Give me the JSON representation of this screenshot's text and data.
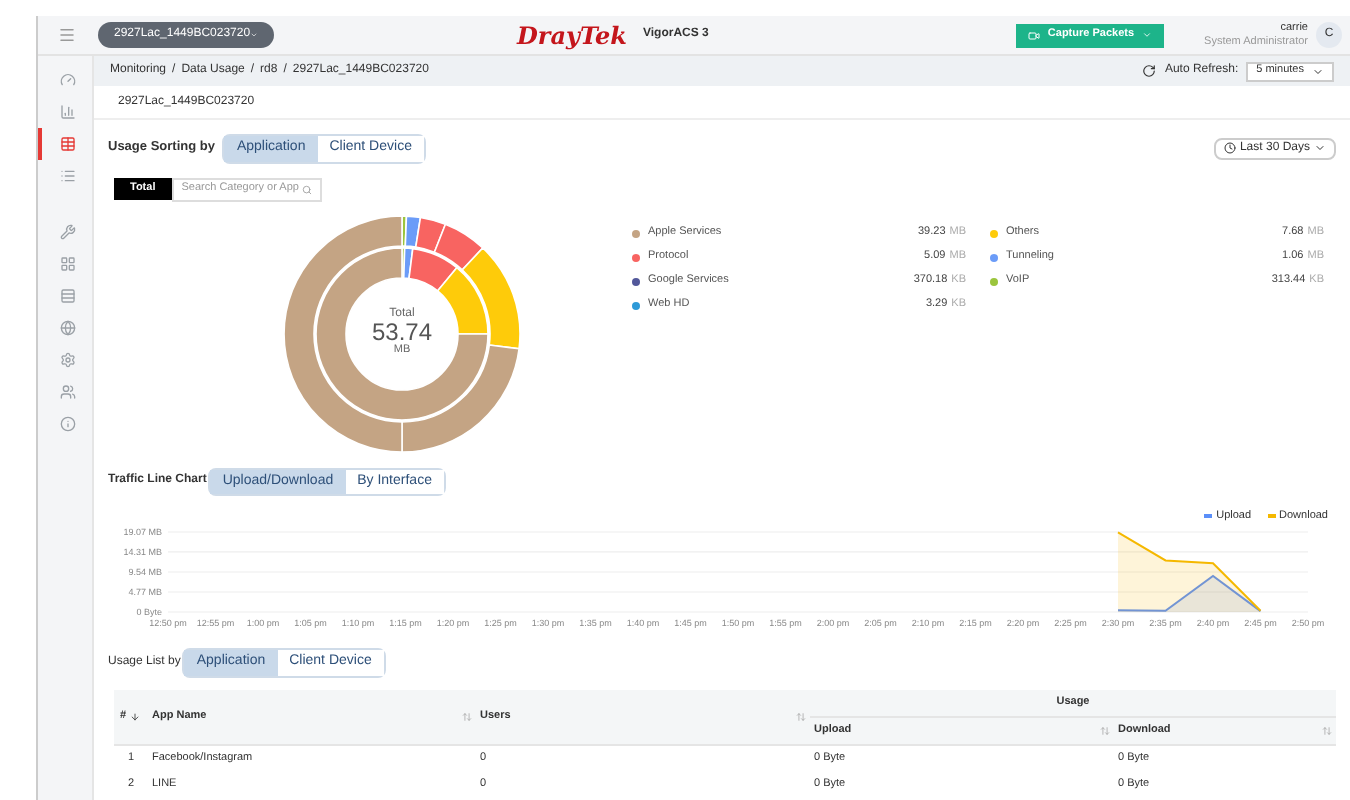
{
  "topbar": {
    "device": "2927Lac_1449BC023720",
    "logo_brand": "DrayTek",
    "logo_product": "VigorACS 3",
    "capture_button": "Capture Packets",
    "user": {
      "name": "carrie",
      "role": "System Administrator",
      "initial": "C"
    }
  },
  "sidebar": {
    "items": [
      {
        "selected": false
      },
      {
        "selected": false
      },
      {
        "selected": true
      },
      {
        "selected": false
      },
      {
        "selected": false
      },
      {
        "selected": false
      },
      {
        "selected": false
      },
      {
        "selected": false
      },
      {
        "selected": false
      },
      {
        "selected": false
      },
      {
        "selected": false
      }
    ]
  },
  "breadcrumb": {
    "separator": "/",
    "items": [
      "Monitoring",
      "Data Usage",
      "rd8",
      "2927Lac_1449BC023720"
    ]
  },
  "auto_refresh": {
    "label": "Auto Refresh:",
    "value": "5 minutes"
  },
  "device_name": "2927Lac_1449BC023720",
  "usage_sorting": {
    "label": "Usage Sorting by",
    "options": [
      {
        "label": "Application",
        "selected": true
      },
      {
        "label": "Client Device",
        "selected": false
      }
    ]
  },
  "date_range": "Last 30 Days",
  "filter": {
    "tag": "Total",
    "placeholder": "Search Category or App"
  },
  "donut": {
    "center_label": "Total",
    "center_value": "53.74",
    "center_unit": "MB"
  },
  "legend": [
    {
      "name": "Apple Services",
      "value": "39.23",
      "unit": "MB",
      "color": "#c4a484"
    },
    {
      "name": "Protocol",
      "value": "5.09",
      "unit": "MB",
      "color": "#f86461"
    },
    {
      "name": "Google Services",
      "value": "370.18",
      "unit": "KB",
      "color": "#52589a"
    },
    {
      "name": "Web HD",
      "value": "3.29",
      "unit": "KB",
      "color": "#2e9ad8"
    },
    {
      "name": "Others",
      "value": "7.68",
      "unit": "MB",
      "color": "#fecb0a"
    },
    {
      "name": "Tunneling",
      "value": "1.06",
      "unit": "MB",
      "color": "#6b9cf8"
    },
    {
      "name": "VoIP",
      "value": "313.44",
      "unit": "KB",
      "color": "#9bc53d"
    }
  ],
  "traffic": {
    "label": "Traffic Line Chart",
    "options": [
      {
        "label": "Upload/Download",
        "selected": true
      },
      {
        "label": "By Interface",
        "selected": false
      }
    ],
    "chart_data": {
      "type": "area",
      "grid": true,
      "ylim": [
        0,
        19.07
      ],
      "categories": [
        "12:50 pm",
        "12:55 pm",
        "1:00 pm",
        "1:05 pm",
        "1:10 pm",
        "1:15 pm",
        "1:20 pm",
        "1:25 pm",
        "1:30 pm",
        "1:35 pm",
        "1:40 pm",
        "1:45 pm",
        "1:50 pm",
        "1:55 pm",
        "2:00 pm",
        "2:05 pm",
        "2:10 pm",
        "2:15 pm",
        "2:20 pm",
        "2:25 pm",
        "2:30 pm",
        "2:35 pm",
        "2:40 pm",
        "2:45 pm",
        "2:50 pm"
      ],
      "yticks": [
        {
          "value": 0,
          "label": "0 Byte"
        },
        {
          "value": 4.77,
          "label": "4.77 MB"
        },
        {
          "value": 9.54,
          "label": "9.54 MB"
        },
        {
          "value": 14.31,
          "label": "14.31 MB"
        },
        {
          "value": 19.07,
          "label": "19.07 MB"
        }
      ],
      "series": [
        {
          "name": "Upload",
          "color": "#5b8ff9",
          "values": [
            null,
            null,
            null,
            null,
            null,
            null,
            null,
            null,
            null,
            null,
            null,
            null,
            null,
            null,
            null,
            null,
            null,
            null,
            null,
            null,
            0.4,
            0.3,
            8.6,
            0.2,
            null
          ]
        },
        {
          "name": "Download",
          "color": "#f5b800",
          "values": [
            null,
            null,
            null,
            null,
            null,
            null,
            null,
            null,
            null,
            null,
            null,
            null,
            null,
            null,
            null,
            null,
            null,
            null,
            null,
            null,
            19,
            12.3,
            11.6,
            0.3,
            null
          ]
        }
      ]
    }
  },
  "usage_list": {
    "label": "Usage List by",
    "options": [
      {
        "label": "Application",
        "selected": true
      },
      {
        "label": "Client Device",
        "selected": false
      }
    ]
  },
  "table": {
    "columns": [
      "#",
      "App Name",
      "Users",
      "Usage",
      "Upload",
      "Download"
    ],
    "rows": [
      {
        "index": "1",
        "app": "Facebook/Instagram",
        "users": "0",
        "upload": "0 Byte",
        "download": "0 Byte"
      },
      {
        "index": "2",
        "app": "LINE",
        "users": "0",
        "upload": "0 Byte",
        "download": "0 Byte"
      }
    ]
  }
}
